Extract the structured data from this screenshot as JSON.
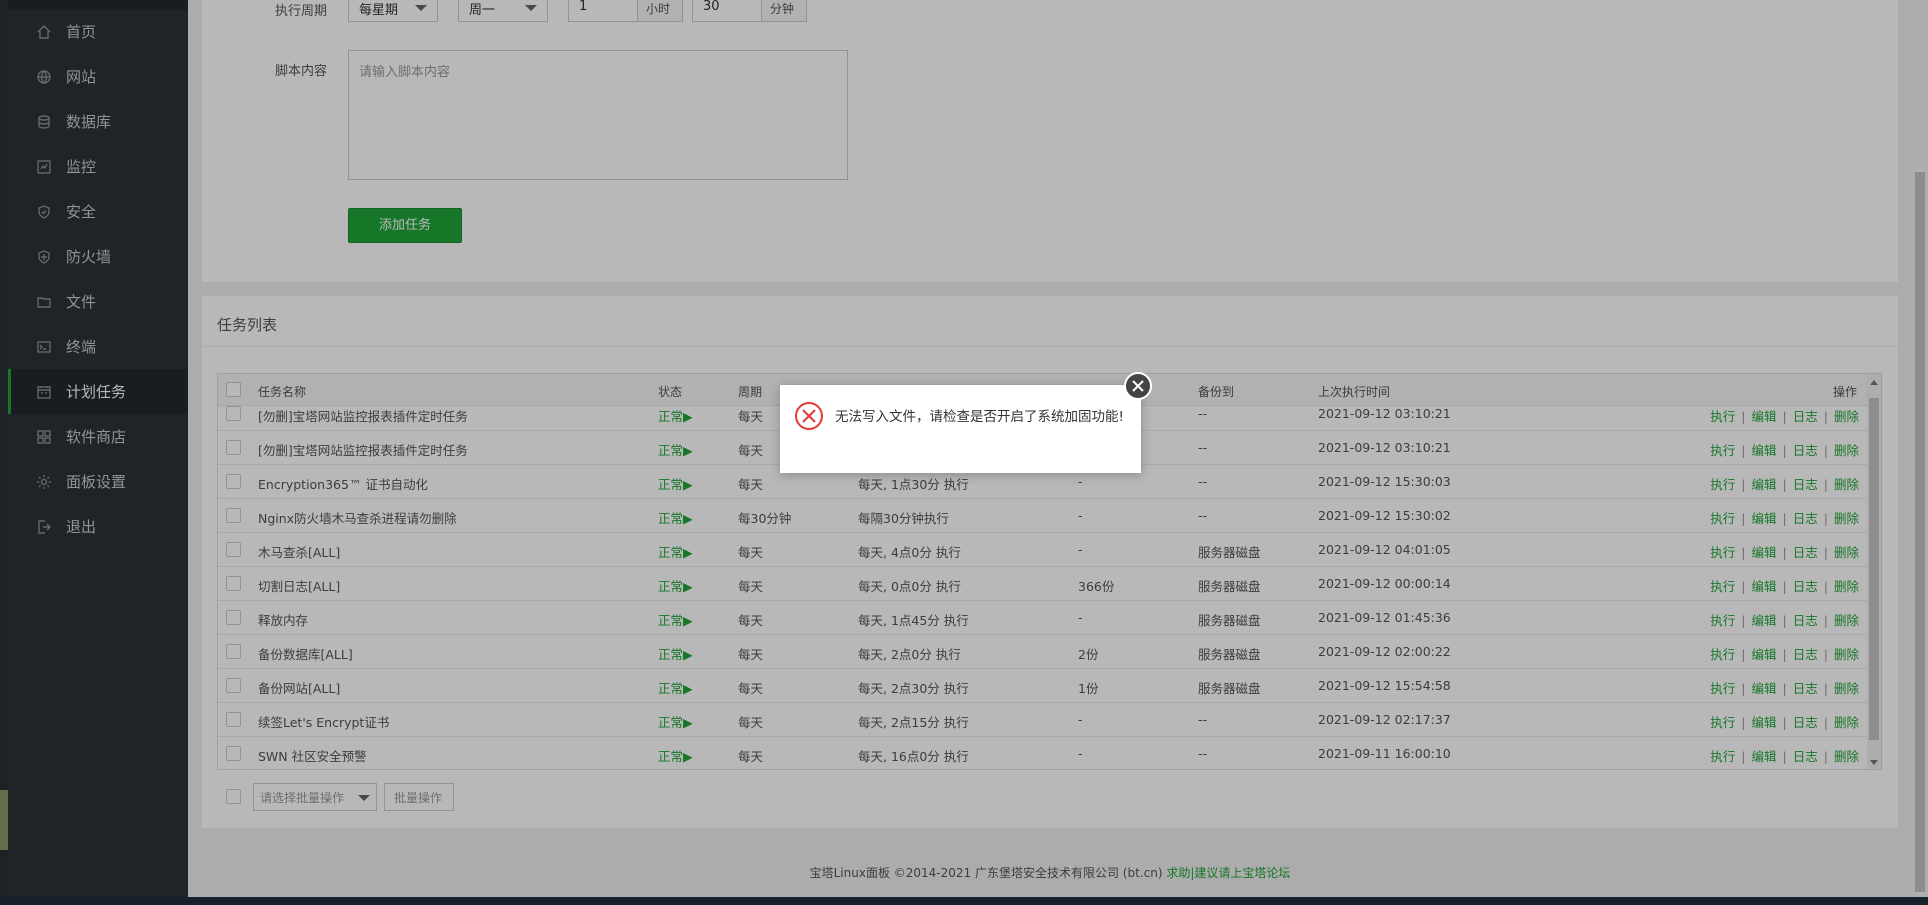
{
  "sidebar": {
    "items": [
      {
        "label": "首页",
        "icon": "home-icon"
      },
      {
        "label": "网站",
        "icon": "globe-icon"
      },
      {
        "label": "数据库",
        "icon": "database-icon"
      },
      {
        "label": "监控",
        "icon": "monitor-icon"
      },
      {
        "label": "安全",
        "icon": "shield-icon"
      },
      {
        "label": "防火墙",
        "icon": "firewall-icon"
      },
      {
        "label": "文件",
        "icon": "folder-icon"
      },
      {
        "label": "终端",
        "icon": "terminal-icon"
      },
      {
        "label": "计划任务",
        "icon": "calendar-icon",
        "active": true
      },
      {
        "label": "软件商店",
        "icon": "apps-icon"
      },
      {
        "label": "面板设置",
        "icon": "gear-icon"
      },
      {
        "label": "退出",
        "icon": "logout-icon"
      }
    ]
  },
  "form": {
    "cycle_label": "执行周期",
    "cycle_value": "每星期",
    "weekday_value": "周一",
    "hour_value": "1",
    "hour_unit": "小时",
    "minute_value": "30",
    "minute_unit": "分钟",
    "script_label": "脚本内容",
    "script_placeholder": "请输入脚本内容",
    "add_button": "添加任务"
  },
  "task_list": {
    "title": "任务列表",
    "headers": {
      "name": "任务名称",
      "status": "状态",
      "cycle": "周期",
      "backup_to": "备份到",
      "last_run": "上次执行时间",
      "ops": "操作"
    },
    "rows": [
      {
        "name": "[勿删]宝塔网站监控报表插件定时任务",
        "status": "正常▶",
        "cycle": "每天",
        "detail": "",
        "keep": "",
        "backup": "--",
        "last": "2021-09-12 03:10:21"
      },
      {
        "name": "[勿删]宝塔网站监控报表插件定时任务",
        "status": "正常▶",
        "cycle": "每天",
        "detail": "",
        "keep": "",
        "backup": "--",
        "last": "2021-09-12 03:10:21"
      },
      {
        "name": "Encryption365™ 证书自动化",
        "status": "正常▶",
        "cycle": "每天",
        "detail": "每天, 1点30分 执行",
        "keep": "-",
        "backup": "--",
        "last": "2021-09-12 15:30:03"
      },
      {
        "name": "Nginx防火墙木马查杀进程请勿删除",
        "status": "正常▶",
        "cycle": "每30分钟",
        "detail": "每隔30分钟执行",
        "keep": "-",
        "backup": "--",
        "last": "2021-09-12 15:30:02"
      },
      {
        "name": "木马查杀[ALL]",
        "status": "正常▶",
        "cycle": "每天",
        "detail": "每天, 4点0分 执行",
        "keep": "-",
        "backup": "服务器磁盘",
        "last": "2021-09-12 04:01:05"
      },
      {
        "name": "切割日志[ALL]",
        "status": "正常▶",
        "cycle": "每天",
        "detail": "每天, 0点0分 执行",
        "keep": "366份",
        "backup": "服务器磁盘",
        "last": "2021-09-12 00:00:14"
      },
      {
        "name": "释放内存",
        "status": "正常▶",
        "cycle": "每天",
        "detail": "每天, 1点45分 执行",
        "keep": "-",
        "backup": "服务器磁盘",
        "last": "2021-09-12 01:45:36"
      },
      {
        "name": "备份数据库[ALL]",
        "status": "正常▶",
        "cycle": "每天",
        "detail": "每天, 2点0分 执行",
        "keep": "2份",
        "backup": "服务器磁盘",
        "last": "2021-09-12 02:00:22"
      },
      {
        "name": "备份网站[ALL]",
        "status": "正常▶",
        "cycle": "每天",
        "detail": "每天, 2点30分 执行",
        "keep": "1份",
        "backup": "服务器磁盘",
        "last": "2021-09-12 15:54:58"
      },
      {
        "name": "续签Let's Encrypt证书",
        "status": "正常▶",
        "cycle": "每天",
        "detail": "每天, 2点15分 执行",
        "keep": "-",
        "backup": "--",
        "last": "2021-09-12 02:17:37"
      },
      {
        "name": "SWN 社区安全预警",
        "status": "正常▶",
        "cycle": "每天",
        "detail": "每天, 16点0分 执行",
        "keep": "-",
        "backup": "--",
        "last": "2021-09-11 16:00:10"
      }
    ],
    "ops": {
      "run": "执行",
      "edit": "编辑",
      "log": "日志",
      "delete": "删除",
      "sep": "|"
    },
    "batch_select": "请选择批量操作",
    "batch_button": "批量操作"
  },
  "footer": {
    "copyright": "宝塔Linux面板 ©2014-2021 广东堡塔安全技术有限公司 (bt.cn)",
    "link": "求助|建议请上宝塔论坛"
  },
  "toast": {
    "message": "无法写入文件，请检查是否开启了系统加固功能!"
  },
  "colors": {
    "accent": "#20a53a",
    "sidebar": "#2b3238",
    "error": "#e53935"
  }
}
